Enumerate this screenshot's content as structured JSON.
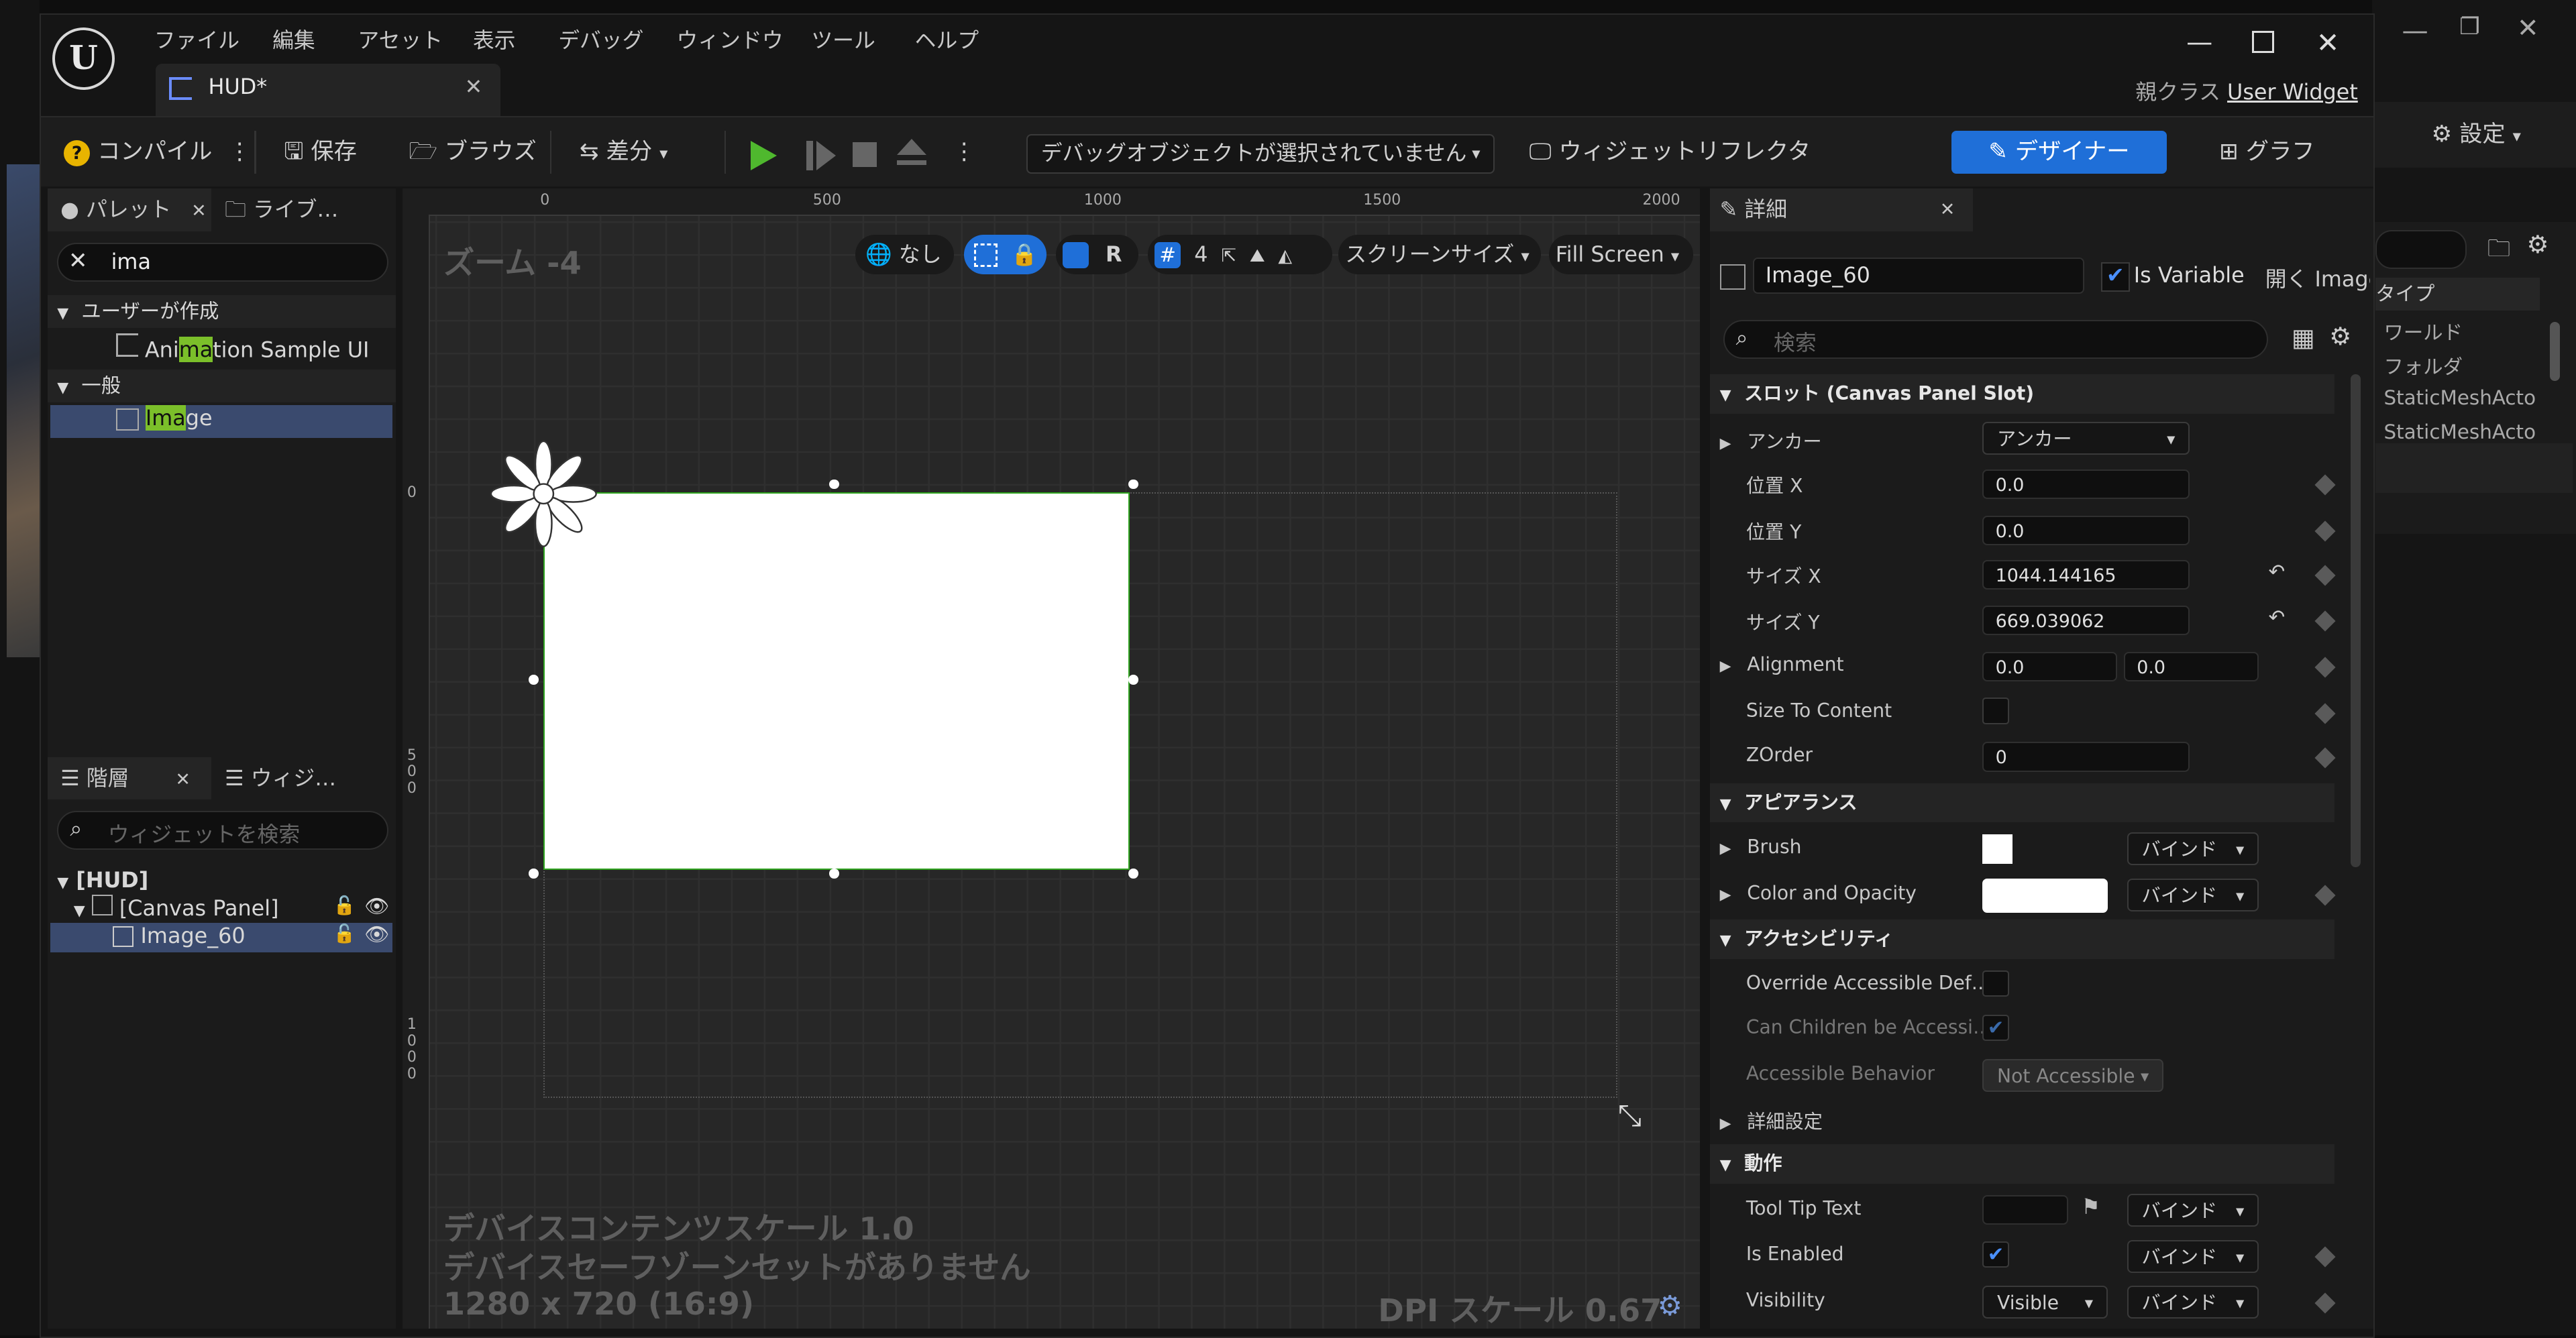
{
  "menu": [
    "ファイル",
    "編集",
    "アセット",
    "表示",
    "デバッグ",
    "ウィンドウ",
    "ツール",
    "ヘルプ"
  ],
  "document_tab": "HUD*",
  "parent_class_label": "親クラス",
  "parent_class_value": "User Widget",
  "toolbar": {
    "compile": "コンパイル",
    "save": "保存",
    "browse": "ブラウズ",
    "diff": "差分",
    "debug_object": "デバッグオブジェクトが選択されていません",
    "widget_reflector": "ウィジェットリフレクタ",
    "designer": "デザイナー",
    "graph": "グラフ"
  },
  "background_right": {
    "settings": "設定",
    "type_header": "タイプ",
    "items": [
      "ワールド",
      "フォルダ",
      "StaticMeshActo",
      "StaticMeshActo"
    ]
  },
  "palette": {
    "tab1": "パレット",
    "tab2": "ライブ…",
    "search_value": "ima",
    "category_user": "ユーザーが作成",
    "item_user_pre": "Ani",
    "item_user_hl": "ma",
    "item_user_post": "tion Sample UI",
    "category_common": "一般",
    "item_common_hl": "Ima",
    "item_common_post": "ge"
  },
  "hierarchy": {
    "tab1": "階層",
    "tab2": "ウィジ…",
    "search_placeholder": "ウィジェットを検索",
    "root": "[HUD]",
    "canvas": "[Canvas Panel]",
    "image": "Image_60"
  },
  "viewport": {
    "zoom": "ズーム -4",
    "none": "なし",
    "r": "R",
    "grid_num": "4",
    "screen_size": "スクリーンサイズ",
    "fill": "Fill Screen",
    "ruler_x": [
      "0",
      "500",
      "1000",
      "1500",
      "2000"
    ],
    "ruler_y_0": "0",
    "ruler_y_500": [
      "5",
      "0",
      "0"
    ],
    "ruler_y_1000": [
      "1",
      "0",
      "0",
      "0"
    ],
    "info1": "デバイスコンテンツスケール 1.0",
    "info2": "デバイスセーフゾーンセットがありません",
    "info3": "1280 x 720 (16:9)",
    "dpi": "DPI スケール 0.67"
  },
  "details": {
    "tab": "詳細",
    "name_value": "Image_60",
    "is_variable": "Is Variable",
    "open": "開く Image",
    "search_placeholder": "検索",
    "sec_slot": "スロット (Canvas Panel Slot)",
    "anchor": "アンカー",
    "anchor_value": "アンカー",
    "pos_x": "位置 X",
    "pos_x_value": "0.0",
    "pos_y": "位置 Y",
    "pos_y_value": "0.0",
    "size_x": "サイズ X",
    "size_x_value": "1044.144165",
    "size_y": "サイズ Y",
    "size_y_value": "669.039062",
    "alignment": "Alignment",
    "alignment_x": "0.0",
    "alignment_y": "0.0",
    "size_to_content": "Size To Content",
    "zorder": "ZOrder",
    "zorder_value": "0",
    "sec_appearance": "アピアランス",
    "brush": "Brush",
    "bind": "バインド",
    "color_opacity": "Color and Opacity",
    "sec_access": "アクセシビリティ",
    "override_access": "Override Accessible Def…",
    "can_children": "Can Children be Accessi…",
    "access_behavior": "Accessible Behavior",
    "not_accessible": "Not Accessible",
    "advanced": "詳細設定",
    "sec_behavior": "動作",
    "tooltip": "Tool Tip Text",
    "is_enabled": "Is Enabled",
    "visibility": "Visibility",
    "visible": "Visible"
  },
  "colors": {
    "accent_blue": "#1f6fd8",
    "green_play": "#4fb82e",
    "selection_green": "#2fa31f",
    "highlight": "#7bbf2a"
  }
}
